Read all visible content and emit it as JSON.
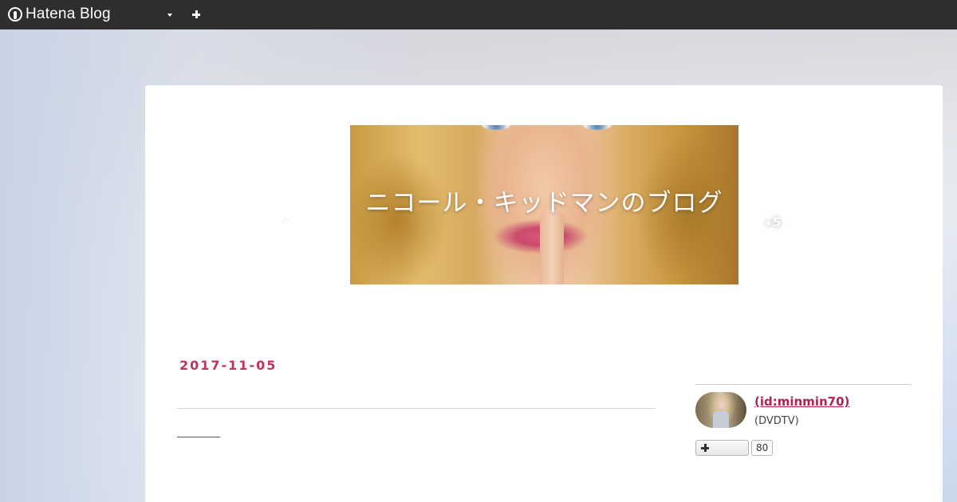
{
  "globalheader": {
    "logo_text": "Hatena Blog"
  },
  "blog": {
    "title": "ニコール・キッドマンのブログ",
    "star_left": "☆",
    "star_right_glyph": "★",
    "star_right_count": "5"
  },
  "entry": {
    "date": "2017-11-05"
  },
  "sidebar": {
    "user_link": " (id:minmin70)",
    "user_desc": "(DVDTV)",
    "follow_count": "80"
  },
  "colors": {
    "accent": "#c1325c",
    "topbar": "#2e2e2e"
  }
}
